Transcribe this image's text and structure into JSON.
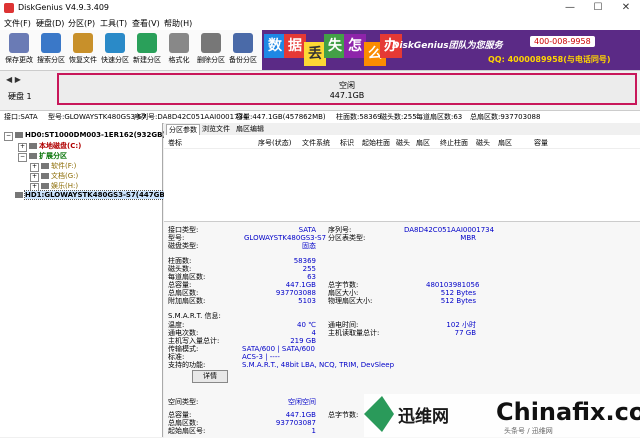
{
  "window": {
    "title": "DiskGenius V4.9.3.409",
    "min": "—",
    "max": "☐",
    "close": "✕"
  },
  "menu": [
    "文件(F)",
    "硬盘(D)",
    "分区(P)",
    "工具(T)",
    "查看(V)",
    "帮助(H)"
  ],
  "toolbar": [
    {
      "label": "保存更改",
      "color": "#6a7bb5"
    },
    {
      "label": "搜索分区",
      "color": "#3a78c8"
    },
    {
      "label": "恢复文件",
      "color": "#c8902a"
    },
    {
      "label": "快速分区",
      "color": "#2a8ac8"
    },
    {
      "label": "新建分区",
      "color": "#2aa05a"
    },
    {
      "label": "格式化",
      "color": "#888888"
    },
    {
      "label": "删除分区",
      "color": "#777777"
    },
    {
      "label": "备份分区",
      "color": "#4a6aa8"
    }
  ],
  "banner": {
    "chars": [
      "数",
      "据",
      "丢",
      "失",
      "怎",
      "么",
      "办"
    ],
    "brand": "DiskGenius团队为您服务",
    "phone": "400-008-9958",
    "qq": "QQ: 4000089958(与电话同号)"
  },
  "diskbar": {
    "nav": "◀ ▶",
    "disk_label": "硬盘 1",
    "free_label": "空闲",
    "free_size": "447.1GB"
  },
  "infoline": [
    "接口:SATA",
    "型号:GLOWAYSTK480GS3-S7",
    "序列号:DA8D42C051AAI0001734",
    "容量:447.1GB(457862MB)",
    "柱面数:58369",
    "磁头数:255",
    "每道扇区数:63",
    "总扇区数:937703088"
  ],
  "tree": [
    {
      "label": "HD0:ST1000DM003-1ER162(932GB)",
      "bold": true,
      "color": "#000000"
    },
    {
      "label": "本地磁盘(C:)",
      "bold": true,
      "color": "#b00000"
    },
    {
      "label": "扩展分区",
      "bold": true,
      "color": "#007000"
    },
    {
      "label": "软件(F:)",
      "bold": false,
      "color": "#8a6a00"
    },
    {
      "label": "文档(G:)",
      "bold": false,
      "color": "#8a6a00"
    },
    {
      "label": "娱乐(H:)",
      "bold": false,
      "color": "#8a6a00"
    },
    {
      "label": "HD1:GLOWAYSTK480GS3-S7(447GB)",
      "bold": true,
      "color": "#000000"
    }
  ],
  "tabs": [
    "分区参数",
    "浏览文件",
    "扇区编辑"
  ],
  "columns": [
    "卷标",
    "序号(状态)",
    "文件系统",
    "标识",
    "起始柱面",
    "磁头",
    "扇区",
    "终止柱面",
    "磁头",
    "扇区",
    "容量"
  ],
  "params": {
    "interface_label": "接口类型:",
    "interface": "SATA",
    "model_label": "型号:",
    "model": "GLOWAYSTK480GS3-S7",
    "disk_type_label": "磁盘类型:",
    "disk_type": "固态",
    "serial_label": "序列号:",
    "serial": "DA8D42C051AAI0001734",
    "table_type_label": "分区表类型:",
    "table_type": "MBR",
    "cylinders_label": "柱面数:",
    "cylinders": "58369",
    "heads_label": "磁头数:",
    "heads": "255",
    "spt_label": "每道扇区数:",
    "spt": "63",
    "capacity_label": "总容量:",
    "capacity": "447.1GB",
    "total_sectors_label": "总扇区数:",
    "total_sectors": "937703088",
    "extra_sectors_label": "附加扇区数:",
    "extra_sectors": "5103",
    "total_bytes_label": "总字节数:",
    "total_bytes": "480103981056",
    "sector_size_label": "扇区大小:",
    "sector_size": "512 Bytes",
    "phys_sector_label": "物理扇区大小:",
    "phys_sector": "512 Bytes",
    "smart_label": "S.M.A.R.T. 信息:",
    "temp_label": "温度:",
    "temp": "40 ℃",
    "power_count_label": "通电次数:",
    "power_count": "4",
    "host_write_label": "主机写入量总计:",
    "host_write": "219 GB",
    "power_time_label": "通电时间:",
    "power_time": "102 小时",
    "host_read_label": "主机读取量总计:",
    "host_read": "77 GB",
    "transfer_label": "传输模式:",
    "transfer": "SATA/600 | SATA/600",
    "standard_label": "标准:",
    "standard": "ACS-3 | ----",
    "features_label": "支持的功能:",
    "features": "S.M.A.R.T., 48bit LBA, NCQ, TRIM, DevSleep",
    "details_button": "详情",
    "space_type_label": "空间类型:",
    "space_type": "空闲空间",
    "space_capacity_label": "总容量:",
    "space_capacity": "447.1GB",
    "space_sectors_label": "总扇区数:",
    "space_sectors": "937703087",
    "start_sector_label": "起始扇区号:",
    "start_sector": "1",
    "space_bytes_label": "总字节数:"
  },
  "watermark": {
    "cn": "迅维网",
    "en": "Chinafix.com",
    "small": "头条号 / 迅维网"
  }
}
